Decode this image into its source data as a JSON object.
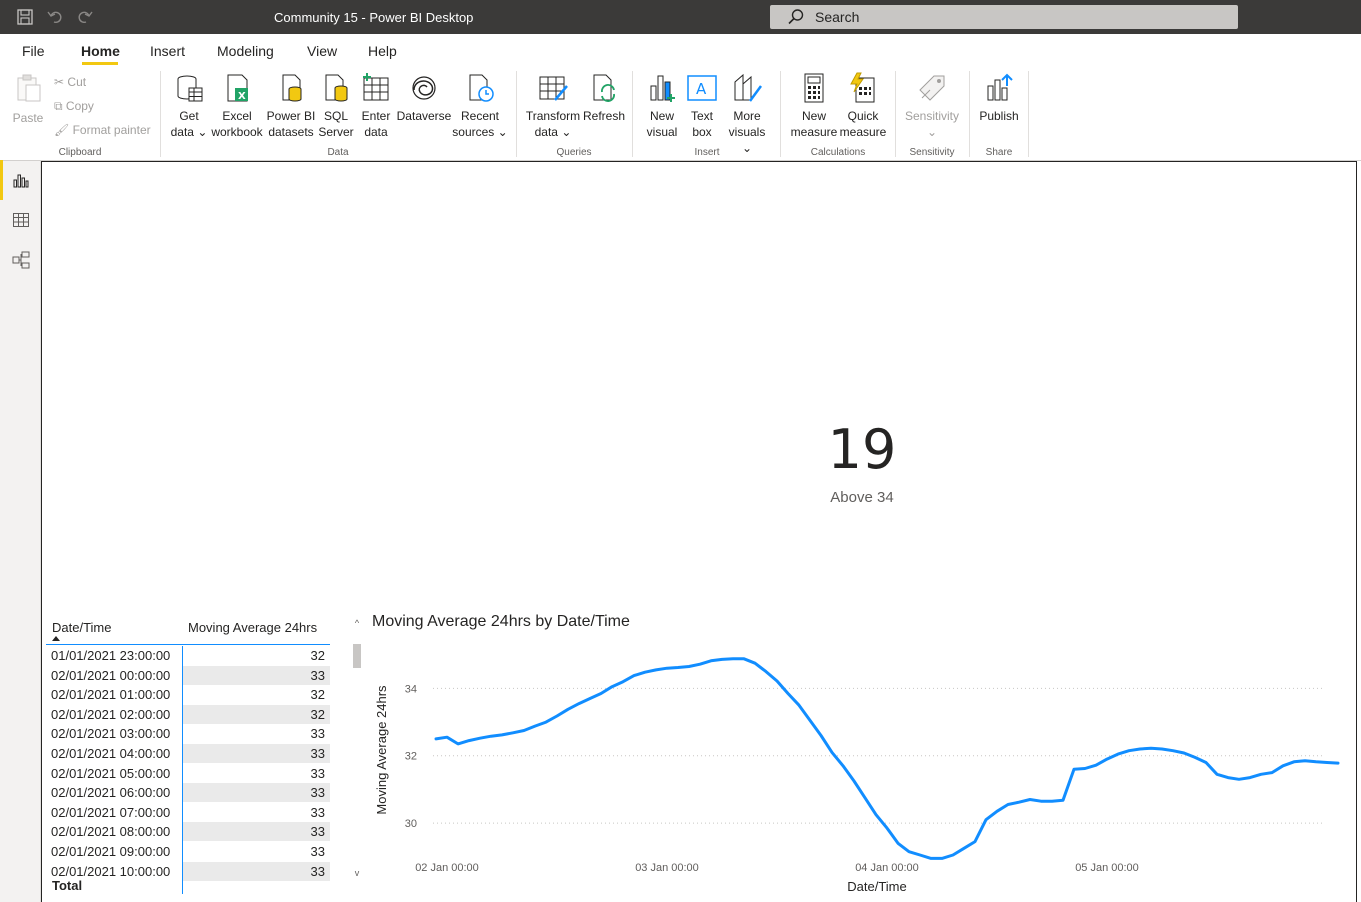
{
  "window": {
    "title": "Community 15 - Power BI Desktop"
  },
  "search": {
    "placeholder": "Search"
  },
  "menu": [
    "File",
    "Home",
    "Insert",
    "Modeling",
    "View",
    "Help"
  ],
  "ribbon": {
    "paste": "Paste",
    "cut": "Cut",
    "copy": "Copy",
    "format_painter": "Format painter",
    "clipboard": "Clipboard",
    "get_data": [
      "Get",
      "data"
    ],
    "excel": [
      "Excel",
      "workbook"
    ],
    "pbi_datasets": [
      "Power BI",
      "datasets"
    ],
    "sql": [
      "SQL",
      "Server"
    ],
    "enter_data": [
      "Enter",
      "data"
    ],
    "dataverse": "Dataverse",
    "recent": [
      "Recent",
      "sources"
    ],
    "data": "Data",
    "transform": [
      "Transform",
      "data"
    ],
    "refresh": "Refresh",
    "queries": "Queries",
    "new_visual": [
      "New",
      "visual"
    ],
    "text_box": [
      "Text",
      "box"
    ],
    "more_visuals": [
      "More",
      "visuals"
    ],
    "insert": "Insert",
    "new_measure": [
      "New",
      "measure"
    ],
    "quick_measure": [
      "Quick",
      "measure"
    ],
    "calculations": "Calculations",
    "sensitivity": "Sensitivity",
    "sensitivity_group": "Sensitivity",
    "publish": "Publish",
    "share": "Share"
  },
  "card": {
    "value": "19",
    "label": "Above 34"
  },
  "table": {
    "headers": [
      "Date/Time",
      "Moving Average 24hrs"
    ],
    "rows": [
      [
        "01/01/2021 23:00:00",
        "32"
      ],
      [
        "02/01/2021 00:00:00",
        "33"
      ],
      [
        "02/01/2021 01:00:00",
        "32"
      ],
      [
        "02/01/2021 02:00:00",
        "32"
      ],
      [
        "02/01/2021 03:00:00",
        "33"
      ],
      [
        "02/01/2021 04:00:00",
        "33"
      ],
      [
        "02/01/2021 05:00:00",
        "33"
      ],
      [
        "02/01/2021 06:00:00",
        "33"
      ],
      [
        "02/01/2021 07:00:00",
        "33"
      ],
      [
        "02/01/2021 08:00:00",
        "33"
      ],
      [
        "02/01/2021 09:00:00",
        "33"
      ],
      [
        "02/01/2021 10:00:00",
        "33"
      ]
    ],
    "total_label": "Total"
  },
  "chart_data": {
    "type": "line",
    "title": "Moving Average 24hrs by Date/Time",
    "xlabel": "Date/Time",
    "ylabel": "Moving Average 24hrs",
    "x_ticks": [
      "02 Jan 00:00",
      "03 Jan 00:00",
      "04 Jan 00:00",
      "05 Jan 00:00"
    ],
    "y_ticks": [
      30,
      32,
      34
    ],
    "ylim": [
      29.2,
      35.2
    ],
    "grid": "horizontal dotted",
    "line_color": "#118dff",
    "series": [
      {
        "x": [
          -0.05,
          0.0,
          0.05,
          0.1,
          0.15,
          0.2,
          0.25,
          0.3,
          0.35,
          0.4,
          0.45,
          0.5,
          0.55,
          0.6,
          0.65,
          0.7,
          0.75,
          0.8,
          0.85,
          0.9,
          0.95,
          1.0,
          1.05,
          1.1,
          1.15,
          1.2,
          1.25,
          1.3,
          1.35,
          1.4,
          1.45,
          1.5,
          1.55,
          1.6,
          1.65,
          1.7,
          1.75,
          1.8,
          1.85,
          1.9,
          1.95,
          2.0,
          2.05,
          2.1,
          2.15,
          2.2,
          2.25,
          2.3,
          2.35,
          2.4,
          2.45,
          2.5,
          2.55,
          2.6,
          2.65,
          2.7,
          2.75,
          2.8,
          2.85,
          2.9,
          2.95,
          3.0,
          3.05,
          3.1,
          3.15,
          3.2,
          3.25,
          3.3,
          3.35,
          3.4,
          3.45,
          3.5,
          3.55,
          3.6,
          3.65,
          3.7,
          3.75,
          3.8,
          3.85,
          3.9,
          3.95,
          4.0,
          4.05
        ],
        "values": [
          32.5,
          32.55,
          32.35,
          32.45,
          32.52,
          32.58,
          32.62,
          32.68,
          32.75,
          32.88,
          33.0,
          33.18,
          33.38,
          33.55,
          33.7,
          33.85,
          34.05,
          34.2,
          34.38,
          34.48,
          34.55,
          34.6,
          34.62,
          34.65,
          34.72,
          34.82,
          34.86,
          34.88,
          34.88,
          34.75,
          34.5,
          34.22,
          33.85,
          33.5,
          33.05,
          32.6,
          32.1,
          31.7,
          31.25,
          30.75,
          30.25,
          29.85,
          29.4,
          29.15,
          29.05,
          28.95,
          28.95,
          29.05,
          29.25,
          29.45,
          30.1,
          30.35,
          30.55,
          30.62,
          30.7,
          30.65,
          30.65,
          30.68,
          31.6,
          31.62,
          31.72,
          31.9,
          32.05,
          32.15,
          32.2,
          32.22,
          32.2,
          32.15,
          32.08,
          31.95,
          31.8,
          31.45,
          31.35,
          31.3,
          31.35,
          31.45,
          31.5,
          31.7,
          31.82,
          31.85,
          31.82,
          31.8,
          31.78
        ]
      }
    ]
  }
}
